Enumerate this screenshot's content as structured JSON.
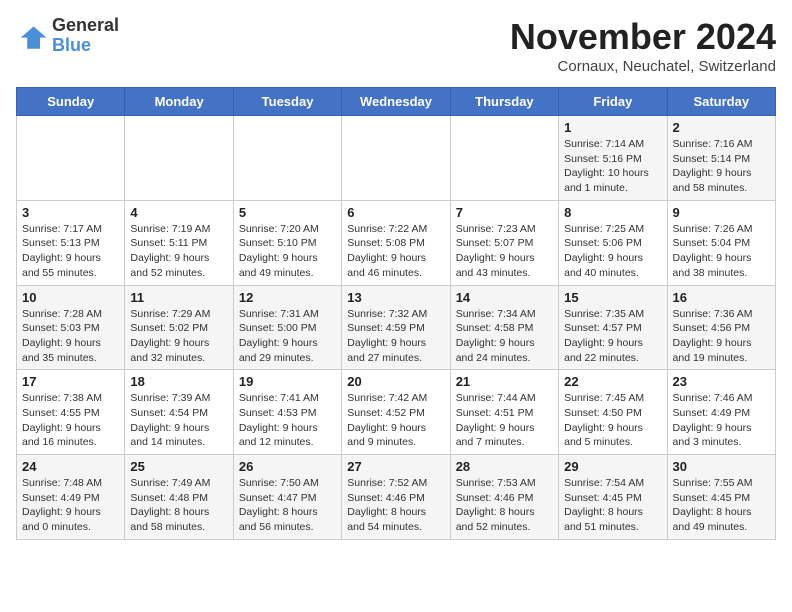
{
  "logo": {
    "text_general": "General",
    "text_blue": "Blue"
  },
  "title": "November 2024",
  "location": "Cornaux, Neuchatel, Switzerland",
  "days_of_week": [
    "Sunday",
    "Monday",
    "Tuesday",
    "Wednesday",
    "Thursday",
    "Friday",
    "Saturday"
  ],
  "weeks": [
    [
      {
        "day": "",
        "info": ""
      },
      {
        "day": "",
        "info": ""
      },
      {
        "day": "",
        "info": ""
      },
      {
        "day": "",
        "info": ""
      },
      {
        "day": "",
        "info": ""
      },
      {
        "day": "1",
        "info": "Sunrise: 7:14 AM\nSunset: 5:16 PM\nDaylight: 10 hours and 1 minute."
      },
      {
        "day": "2",
        "info": "Sunrise: 7:16 AM\nSunset: 5:14 PM\nDaylight: 9 hours and 58 minutes."
      }
    ],
    [
      {
        "day": "3",
        "info": "Sunrise: 7:17 AM\nSunset: 5:13 PM\nDaylight: 9 hours and 55 minutes."
      },
      {
        "day": "4",
        "info": "Sunrise: 7:19 AM\nSunset: 5:11 PM\nDaylight: 9 hours and 52 minutes."
      },
      {
        "day": "5",
        "info": "Sunrise: 7:20 AM\nSunset: 5:10 PM\nDaylight: 9 hours and 49 minutes."
      },
      {
        "day": "6",
        "info": "Sunrise: 7:22 AM\nSunset: 5:08 PM\nDaylight: 9 hours and 46 minutes."
      },
      {
        "day": "7",
        "info": "Sunrise: 7:23 AM\nSunset: 5:07 PM\nDaylight: 9 hours and 43 minutes."
      },
      {
        "day": "8",
        "info": "Sunrise: 7:25 AM\nSunset: 5:06 PM\nDaylight: 9 hours and 40 minutes."
      },
      {
        "day": "9",
        "info": "Sunrise: 7:26 AM\nSunset: 5:04 PM\nDaylight: 9 hours and 38 minutes."
      }
    ],
    [
      {
        "day": "10",
        "info": "Sunrise: 7:28 AM\nSunset: 5:03 PM\nDaylight: 9 hours and 35 minutes."
      },
      {
        "day": "11",
        "info": "Sunrise: 7:29 AM\nSunset: 5:02 PM\nDaylight: 9 hours and 32 minutes."
      },
      {
        "day": "12",
        "info": "Sunrise: 7:31 AM\nSunset: 5:00 PM\nDaylight: 9 hours and 29 minutes."
      },
      {
        "day": "13",
        "info": "Sunrise: 7:32 AM\nSunset: 4:59 PM\nDaylight: 9 hours and 27 minutes."
      },
      {
        "day": "14",
        "info": "Sunrise: 7:34 AM\nSunset: 4:58 PM\nDaylight: 9 hours and 24 minutes."
      },
      {
        "day": "15",
        "info": "Sunrise: 7:35 AM\nSunset: 4:57 PM\nDaylight: 9 hours and 22 minutes."
      },
      {
        "day": "16",
        "info": "Sunrise: 7:36 AM\nSunset: 4:56 PM\nDaylight: 9 hours and 19 minutes."
      }
    ],
    [
      {
        "day": "17",
        "info": "Sunrise: 7:38 AM\nSunset: 4:55 PM\nDaylight: 9 hours and 16 minutes."
      },
      {
        "day": "18",
        "info": "Sunrise: 7:39 AM\nSunset: 4:54 PM\nDaylight: 9 hours and 14 minutes."
      },
      {
        "day": "19",
        "info": "Sunrise: 7:41 AM\nSunset: 4:53 PM\nDaylight: 9 hours and 12 minutes."
      },
      {
        "day": "20",
        "info": "Sunrise: 7:42 AM\nSunset: 4:52 PM\nDaylight: 9 hours and 9 minutes."
      },
      {
        "day": "21",
        "info": "Sunrise: 7:44 AM\nSunset: 4:51 PM\nDaylight: 9 hours and 7 minutes."
      },
      {
        "day": "22",
        "info": "Sunrise: 7:45 AM\nSunset: 4:50 PM\nDaylight: 9 hours and 5 minutes."
      },
      {
        "day": "23",
        "info": "Sunrise: 7:46 AM\nSunset: 4:49 PM\nDaylight: 9 hours and 3 minutes."
      }
    ],
    [
      {
        "day": "24",
        "info": "Sunrise: 7:48 AM\nSunset: 4:49 PM\nDaylight: 9 hours and 0 minutes."
      },
      {
        "day": "25",
        "info": "Sunrise: 7:49 AM\nSunset: 4:48 PM\nDaylight: 8 hours and 58 minutes."
      },
      {
        "day": "26",
        "info": "Sunrise: 7:50 AM\nSunset: 4:47 PM\nDaylight: 8 hours and 56 minutes."
      },
      {
        "day": "27",
        "info": "Sunrise: 7:52 AM\nSunset: 4:46 PM\nDaylight: 8 hours and 54 minutes."
      },
      {
        "day": "28",
        "info": "Sunrise: 7:53 AM\nSunset: 4:46 PM\nDaylight: 8 hours and 52 minutes."
      },
      {
        "day": "29",
        "info": "Sunrise: 7:54 AM\nSunset: 4:45 PM\nDaylight: 8 hours and 51 minutes."
      },
      {
        "day": "30",
        "info": "Sunrise: 7:55 AM\nSunset: 4:45 PM\nDaylight: 8 hours and 49 minutes."
      }
    ]
  ]
}
